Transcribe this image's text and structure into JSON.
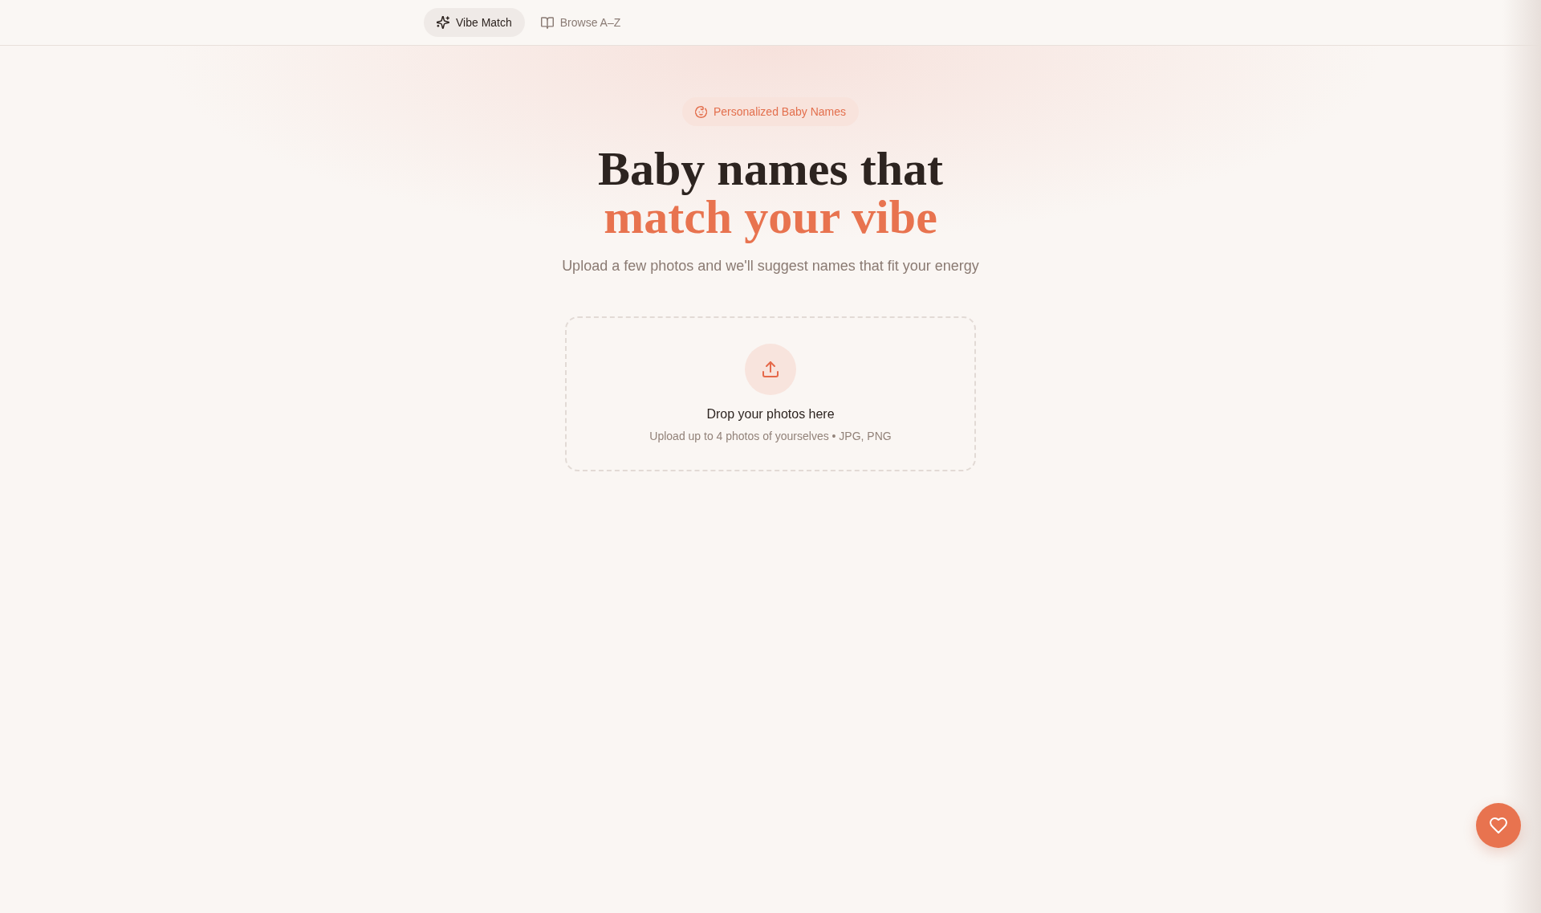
{
  "nav": {
    "tabs": [
      {
        "label": "Vibe Match",
        "selected": true
      },
      {
        "label": "Browse A–Z",
        "selected": false
      }
    ]
  },
  "hero": {
    "badge": "Personalized Baby Names",
    "title": "Baby names that",
    "title_highlight": "match your vibe",
    "subtitle": "Upload a few photos and we'll suggest names that fit your energy"
  },
  "upload": {
    "title": "Drop your photos here",
    "hint": "Upload up to 4 photos of yourselves • JPG, PNG"
  }
}
